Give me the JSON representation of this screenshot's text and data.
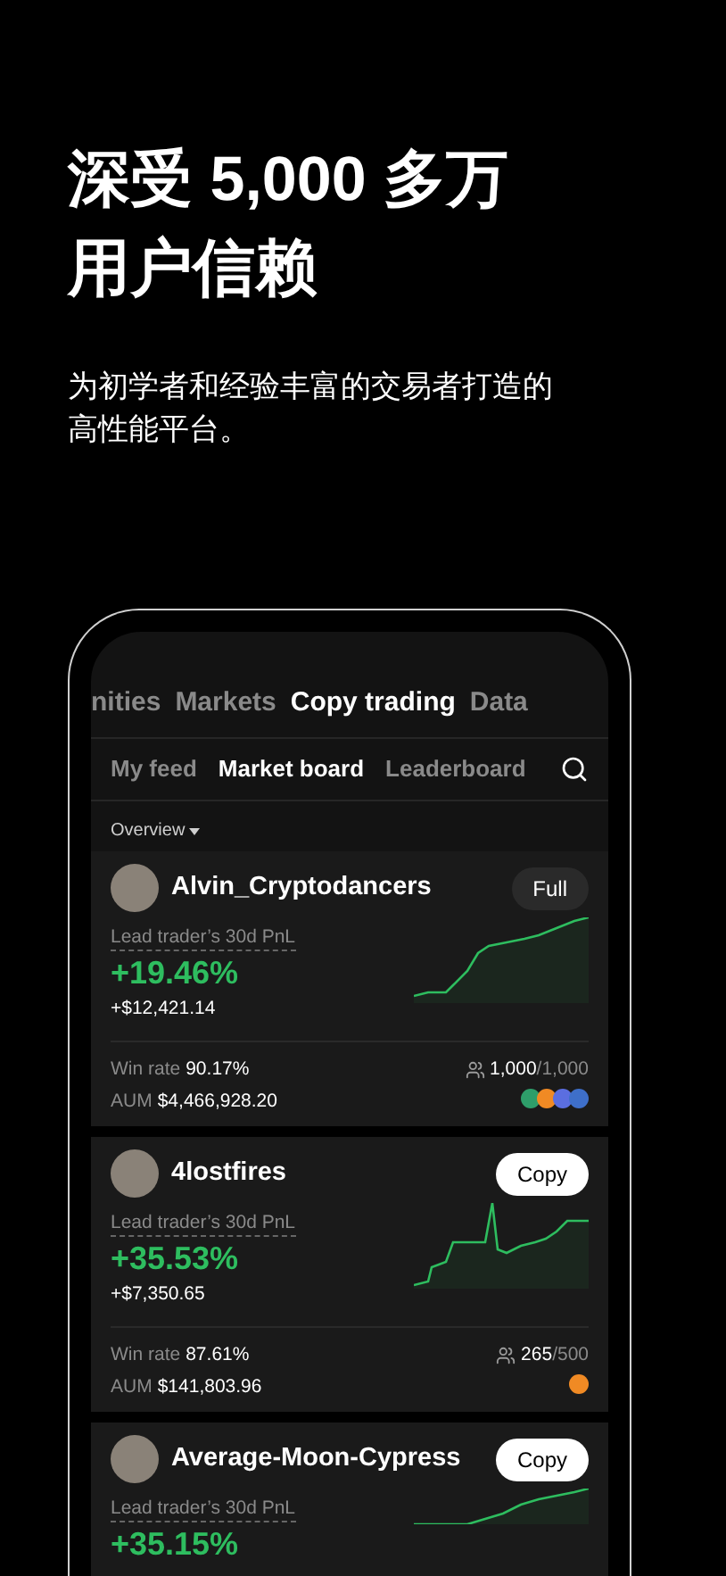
{
  "headline": [
    "深受 5,000 多万",
    "用户信赖"
  ],
  "subtitle": [
    "为初学者和经验丰富的交易者打造的",
    "高性能平台。"
  ],
  "top_tabs": [
    {
      "label": "nities",
      "selected": false
    },
    {
      "label": "Markets",
      "selected": false
    },
    {
      "label": "Copy trading",
      "selected": true
    },
    {
      "label": "Data",
      "selected": false
    }
  ],
  "sub_tabs": [
    {
      "label": "My feed",
      "selected": false
    },
    {
      "label": "Market board",
      "selected": true
    },
    {
      "label": "Leaderboard",
      "selected": false
    }
  ],
  "filter": "Overview",
  "traders": [
    {
      "name": "Alvin_Cryptodancers",
      "button": {
        "kind": "full",
        "label": "Full"
      },
      "pnl_label": "Lead trader’s 30d PnL",
      "pnl_percent": "+19.46%",
      "pnl_amount": "+$12,421.14",
      "win_rate_label": "Win rate",
      "win_rate": "90.17%",
      "aum_label": "AUM",
      "aum": "$4,466,928.20",
      "copiers": "1,000",
      "capacity": "/1,000",
      "coins": [
        {
          "color": "#2e9e6a"
        },
        {
          "color": "#f08a24"
        },
        {
          "color": "#5b6ee0"
        },
        {
          "color": "#3e6fc9"
        }
      ]
    },
    {
      "name": "4lostfires",
      "button": {
        "kind": "copy",
        "label": "Copy"
      },
      "pnl_label": "Lead trader’s 30d PnL",
      "pnl_percent": "+35.53%",
      "pnl_amount": "+$7,350.65",
      "win_rate_label": "Win rate",
      "win_rate": "87.61%",
      "aum_label": "AUM",
      "aum": "$141,803.96",
      "copiers": "265",
      "capacity": "/500",
      "coins": [
        {
          "color": "#f08a24"
        }
      ]
    },
    {
      "name": "Average-Moon-Cypress",
      "button": {
        "kind": "copy",
        "label": "Copy"
      },
      "pnl_label": "Lead trader’s 30d PnL",
      "pnl_percent": "+35.15%"
    }
  ]
}
